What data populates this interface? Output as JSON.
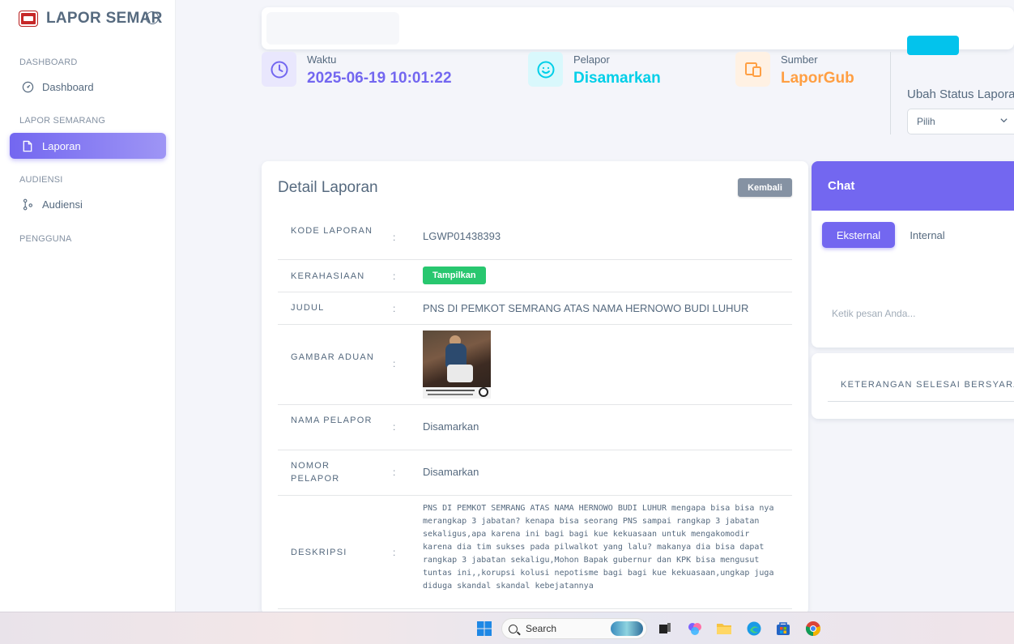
{
  "sidebar": {
    "brand": "LAPOR SEMAR",
    "sections": [
      {
        "header": "DASHBOARD",
        "item": "Dashboard",
        "icon": "gauge-icon"
      },
      {
        "header": "LAPOR SEMARANG",
        "item": "Laporan",
        "icon": "file-icon"
      },
      {
        "header": "AUDIENSI",
        "item": "Audiensi",
        "icon": "branch-icon"
      },
      {
        "header": "PENGGUNA"
      }
    ]
  },
  "stats": [
    {
      "label": "Waktu",
      "value": "2025-06-19 10:01:22",
      "color": "#7367f0",
      "icon": "clock-icon"
    },
    {
      "label": "Pelapor",
      "value": "Disamarkan",
      "color": "#00cfe8",
      "icon": "smile-icon"
    },
    {
      "label": "Sumber",
      "value": "LaporGub",
      "color": "#ff9f43",
      "icon": "devices-icon"
    }
  ],
  "status": {
    "label": "Ubah Status Laporan",
    "select_value": "Pilih"
  },
  "detail": {
    "title": "Detail Laporan",
    "back_label": "Kembali",
    "rows": [
      {
        "key": "KODE LAPORAN",
        "value": "LGWP01438393"
      },
      {
        "key": "KERAHASIAAN",
        "value": "Tampilkan"
      },
      {
        "key": "JUDUL",
        "value": "PNS DI PEMKOT SEMRANG ATAS NAMA HERNOWO BUDI LUHUR"
      },
      {
        "key": "GAMBAR ADUAN",
        "value": ""
      },
      {
        "key": "NAMA PELAPOR",
        "value": "Disamarkan"
      },
      {
        "key": "NOMOR PELAPOR",
        "value": "Disamarkan"
      },
      {
        "key": "DESKRIPSI",
        "value": "PNS DI PEMKOT SEMRANG ATAS NAMA HERNOWO BUDI LUHUR mengapa bisa bisa nya\nmerangkap 3 jabatan? kenapa bisa seorang PNS sampai rangkap 3 jabatan\nsekaligus,apa karena ini bagi bagi kue kekuasaan untuk mengakomodir\nkarena dia tim sukses pada pilwalkot yang lalu? makanya dia bisa dapat\nrangkap 3 jabatan sekaligu,Mohon Bapak gubernur dan KPK bisa mengusut\ntuntas ini,,korupsi kolusi nepotisme bagi bagi kue kekuasaan,ungkap juga\ndiduga skandal skandal kebejatannya"
      }
    ]
  },
  "chat": {
    "title": "Chat",
    "tabs": [
      "Eksternal",
      "Internal"
    ],
    "input_placeholder": "Ketik pesan Anda..."
  },
  "keterangan": "KETERANGAN SELESAI BERSYARAT",
  "taskbar": {
    "search": "Search"
  }
}
